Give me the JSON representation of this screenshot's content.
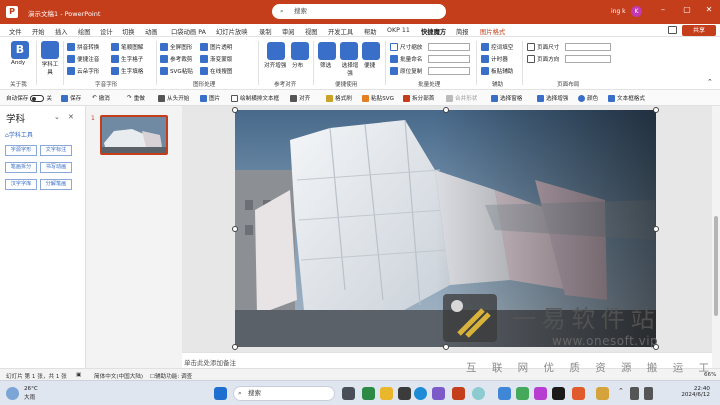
{
  "titlebar": {
    "doc_title": "演示文稿1 - PowerPoint",
    "search_placeholder": "搜索",
    "user_name": "ing k",
    "avatar_initial": "K"
  },
  "menu": {
    "tabs": [
      "文件",
      "开始",
      "插入",
      "绘图",
      "设计",
      "切换",
      "动画",
      "口袋动画 PA",
      "幻灯片放映",
      "录制",
      "审阅",
      "视图",
      "开发工具",
      "帮助",
      "OKP 11",
      "快捷魔方",
      "简报",
      "图片格式"
    ],
    "active_tab": "快捷魔方",
    "share_label": "共享"
  },
  "ribbon": {
    "about": {
      "btn_name": "Andy",
      "group": "关于我"
    },
    "learn": {
      "btn_name": "学科工具"
    },
    "font_group": {
      "label": "字音字形",
      "items": [
        "拼音转换",
        "笔顺图解",
        "便捷注音",
        "生字格子",
        "云朵字形",
        "生字填格"
      ]
    },
    "shape_group": {
      "label": "图形处理",
      "items": [
        "全屏图形",
        "图片透明",
        "参考裁剪",
        "渐变蒙版",
        "SVG粘贴",
        "在线搜图"
      ]
    },
    "align_group": {
      "label": "参考对齐",
      "items": [
        "对齐增强",
        "分布"
      ]
    },
    "use_group": {
      "label": "便捷使用",
      "items": [
        "筛选",
        "选择增强",
        "便捷"
      ]
    },
    "batch_group": {
      "label": "批量处理",
      "items": [
        "尺寸缩放",
        "批量命名",
        "原位复制"
      ]
    },
    "assist_group": {
      "label": "辅助",
      "items": [
        "控词填空",
        "计时器",
        "板贴辅助"
      ]
    },
    "layout_group": {
      "label": "页面布局",
      "items": [
        "页面尺寸",
        "页面方向"
      ]
    }
  },
  "qat": {
    "autosave": "自动保存",
    "autosave_state": "关",
    "items": [
      "保存",
      "撤消",
      "重做",
      "从头开始",
      "图片",
      "绘制横排文本框",
      "对齐",
      "格式刷",
      "粘贴SVG",
      "拆分部首",
      "合并形状",
      "选择窗格",
      "选择增强",
      "颜色",
      "文本框格式"
    ]
  },
  "left_pane": {
    "title": "学科",
    "section": "学科工具",
    "buttons": [
      "字源字形",
      "文字标注",
      "笔画拆分",
      "书写动画",
      "汉字字库",
      "分解笔画"
    ]
  },
  "slides": {
    "current_number": "1"
  },
  "notes": {
    "placeholder": "单击此处添加备注"
  },
  "watermark": {
    "text": "一 易 软 件 站",
    "url": "www.onesoft.vip",
    "slogan": "互 联 网 优 质 资 源 搬 运 工"
  },
  "status": {
    "slide_info": "幻灯片 第 1 张，共 1 张",
    "language": "简体中文(中国大陆)",
    "accessibility": "辅助功能: 调查",
    "zoom": "66%"
  },
  "taskbar": {
    "temperature": "26°C",
    "weather": "大雨",
    "search": "搜索",
    "time": "22:40",
    "date": "2024/6/12"
  },
  "colors": {
    "accent": "#c43e1c",
    "taskbar": "#dfe6ef"
  }
}
